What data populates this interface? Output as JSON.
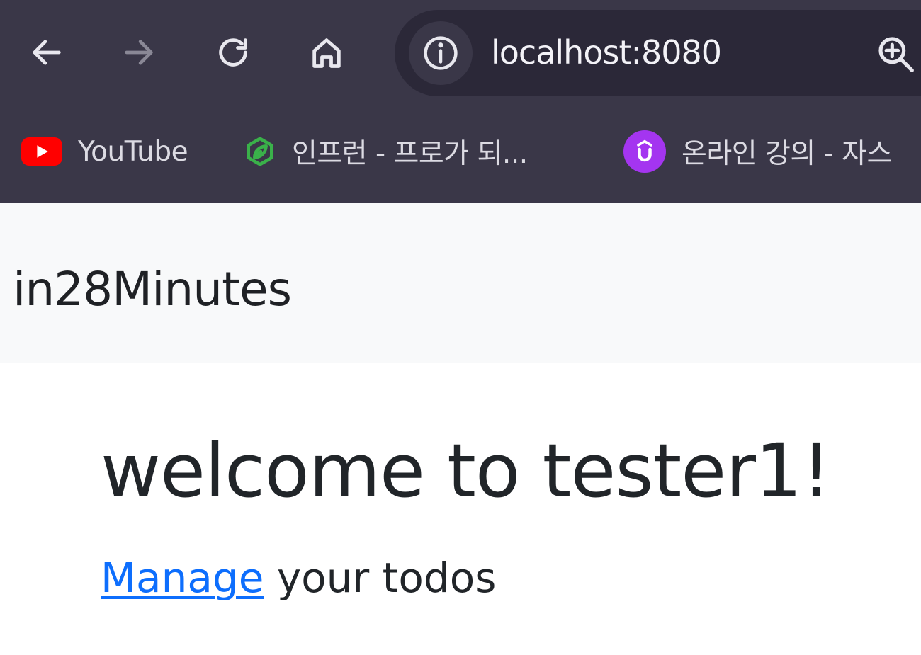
{
  "browser": {
    "address": "localhost:8080",
    "icons": {
      "back": "arrow-left-icon",
      "forward": "arrow-right-icon",
      "reload": "reload-icon",
      "home": "home-icon",
      "site_info": "info-icon",
      "zoom": "zoom-in-icon"
    },
    "bookmarks": [
      {
        "label": "YouTube",
        "icon": "youtube-icon"
      },
      {
        "label": "인프런 - 프로가 되...",
        "icon": "inflearn-icon"
      },
      {
        "label": "온라인 강의 - 자스",
        "icon": "udemy-icon"
      }
    ],
    "colors": {
      "chrome_bg": "#3a3748",
      "urlbar_bg": "#2b2838",
      "youtube_red": "#ff0000",
      "inflearn_green": "#3ab14a",
      "udemy_purple": "#a435f0"
    }
  },
  "page": {
    "brand": "in28Minutes",
    "welcome": "welcome to tester1!",
    "manage_link": "Manage",
    "manage_rest": " your todos",
    "colors": {
      "navbar_bg": "#f8f9fa",
      "text": "#212529",
      "link": "#0d6efd"
    }
  }
}
